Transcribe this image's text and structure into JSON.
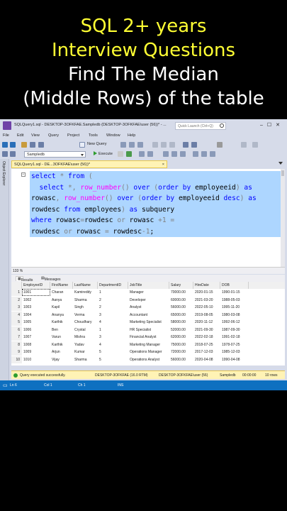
{
  "caption": {
    "line1": "SQL 2+ years",
    "line2": "Interview Questions",
    "line3": "Find The Median",
    "line4": "(Middle Rows) of the table"
  },
  "window": {
    "title": "SQLQuery1.sql - DESKTOP-3OFKFAE.Sampledb (DESKTOP-3OFKFAE\\user (56))* - ...",
    "quick_launch_placeholder": "Quick Launch (Ctrl+Q)"
  },
  "menu": [
    "File",
    "Edit",
    "View",
    "Query",
    "Project",
    "Tools",
    "Window",
    "Help"
  ],
  "toolbar": {
    "new_query": "New Query",
    "database": "Sampledb",
    "execute": "Execute"
  },
  "side_panel": "Object Explorer",
  "doc_tab": {
    "title": "SQLQuery1.sql - DE...3OFKFAE\\user (56))*",
    "pin": "⊸",
    "close": "×"
  },
  "code_lines": [
    [
      {
        "t": "select ",
        "c": "kw"
      },
      {
        "t": "* ",
        "c": "op"
      },
      {
        "t": "from ",
        "c": "kw"
      },
      {
        "t": "(",
        "c": "op"
      }
    ],
    [
      {
        "t": "  select ",
        "c": "kw"
      },
      {
        "t": "*, ",
        "c": "op"
      },
      {
        "t": "row_number",
        "c": "fn"
      },
      {
        "t": "() ",
        "c": "op"
      },
      {
        "t": "over ",
        "c": "kw"
      },
      {
        "t": "(",
        "c": "op"
      },
      {
        "t": "order by ",
        "c": "kw"
      },
      {
        "t": "employeeid",
        "c": "tx"
      },
      {
        "t": ") ",
        "c": "op"
      },
      {
        "t": "as",
        "c": "kw"
      }
    ],
    [
      {
        "t": "rowasc",
        "c": "tx"
      },
      {
        "t": ", ",
        "c": "op"
      },
      {
        "t": "row_number",
        "c": "fn"
      },
      {
        "t": "() ",
        "c": "op"
      },
      {
        "t": "over ",
        "c": "kw"
      },
      {
        "t": "(",
        "c": "op"
      },
      {
        "t": "order by ",
        "c": "kw"
      },
      {
        "t": "employeeid ",
        "c": "tx"
      },
      {
        "t": "desc",
        "c": "kw"
      },
      {
        "t": ") ",
        "c": "op"
      },
      {
        "t": "as",
        "c": "kw"
      }
    ],
    [
      {
        "t": "rowdesc ",
        "c": "tx"
      },
      {
        "t": "from ",
        "c": "kw"
      },
      {
        "t": "employees",
        "c": "tx"
      },
      {
        "t": ") ",
        "c": "op"
      },
      {
        "t": "as ",
        "c": "kw"
      },
      {
        "t": "subquery",
        "c": "tx"
      }
    ],
    [
      {
        "t": "where ",
        "c": "kw"
      },
      {
        "t": "rowasc",
        "c": "tx"
      },
      {
        "t": "=",
        "c": "op"
      },
      {
        "t": "rowdesc ",
        "c": "tx"
      },
      {
        "t": "or ",
        "c": "op"
      },
      {
        "t": "rowasc ",
        "c": "tx"
      },
      {
        "t": "+1 ",
        "c": "op"
      },
      {
        "t": "=",
        "c": "op"
      }
    ],
    [
      {
        "t": "rowdesc ",
        "c": "tx"
      },
      {
        "t": "or ",
        "c": "op"
      },
      {
        "t": "rowasc ",
        "c": "tx"
      },
      {
        "t": "= ",
        "c": "op"
      },
      {
        "t": "rowdesc",
        "c": "tx"
      },
      {
        "t": "-1",
        "c": "op"
      },
      {
        "t": ";",
        "c": "tx"
      }
    ]
  ],
  "zoom": "133 %",
  "result_tabs": {
    "results": "Results",
    "messages": "Messages"
  },
  "columns": [
    "EmployeeID",
    "FirstName",
    "LastName",
    "DepartmentID",
    "JobTitle",
    "Salary",
    "HireDate",
    "DOB"
  ],
  "rows": [
    [
      "1",
      "1001",
      "Charan",
      "Kamireddy",
      "1",
      "Manager",
      "70000.00",
      "2020-01-15",
      "1990-01-15"
    ],
    [
      "2",
      "1002",
      "Aanya",
      "Sharma",
      "2",
      "Developer",
      "60000.00",
      "2021-03-20",
      "1988-05-03"
    ],
    [
      "3",
      "1003",
      "Kapil",
      "Singh",
      "2",
      "Analyst",
      "56000.00",
      "2022-05-10",
      "1995-11-20"
    ],
    [
      "4",
      "1004",
      "Ananya",
      "Verma",
      "3",
      "Accountant",
      "65000.00",
      "2019-08-05",
      "1980-03-08"
    ],
    [
      "5",
      "1005",
      "Karthik",
      "Choudhary",
      "4",
      "Marketing Specialist",
      "58000.00",
      "2020-11-12",
      "1992-06-12"
    ],
    [
      "6",
      "1006",
      "Ben",
      "Crystal",
      "1",
      "HR Specialist",
      "52000.00",
      "2021-09-30",
      "1987-09-30"
    ],
    [
      "7",
      "1007",
      "Varun",
      "Mishra",
      "3",
      "Financial Analyst",
      "62000.00",
      "2022-02-18",
      "1991-02-18"
    ],
    [
      "8",
      "1008",
      "Karthik",
      "Yadav",
      "4",
      "Marketing Manager",
      "75000.00",
      "2018-07-25",
      "1978-07-25"
    ],
    [
      "9",
      "1009",
      "Arjun",
      "Kumar",
      "5",
      "Operations Manager",
      "72000.00",
      "2017-12-03",
      "1985-12-03"
    ],
    [
      "10",
      "1010",
      "Vijay",
      "Sharma",
      "5",
      "Operations Analyst",
      "56000.00",
      "2020-04-08",
      "1990-04-08"
    ]
  ],
  "query_status": {
    "message": "Query executed successfully.",
    "server": "DESKTOP-3OFKFAE (16.0 RTM)",
    "user": "DESKTOP-3OFKFAE\\user (56)",
    "db": "Sampledb",
    "time": "00:00:00",
    "rows": "10 rows"
  },
  "statusbar": {
    "ln": "Ln 6",
    "col": "Col 1",
    "ch": "Ch 1",
    "ins": "INS"
  },
  "colors": {
    "accent": "#0e70c0",
    "keyword": "#0000ff",
    "function": "#ff00ff",
    "selection": "#add6ff",
    "caption_yellow": "#ffff33"
  }
}
